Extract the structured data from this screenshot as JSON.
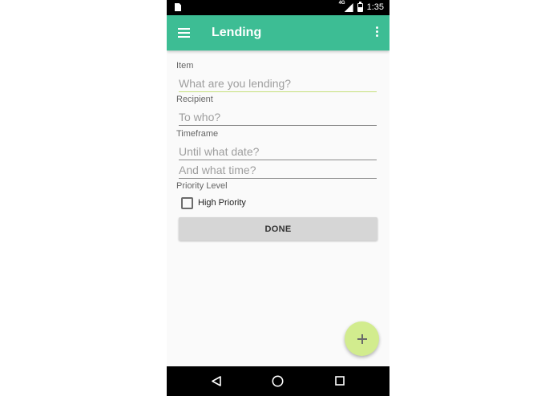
{
  "status_bar": {
    "network_label": "4G",
    "time": "1:35",
    "icons": [
      "sim-card-icon",
      "signal-icon",
      "battery-icon"
    ]
  },
  "app_bar": {
    "title": "Lending",
    "background_color": "#3dbd94",
    "icons": [
      "menu-icon",
      "overflow-menu-icon"
    ]
  },
  "form": {
    "item": {
      "label": "Item",
      "value": "",
      "placeholder": "What are you lending?"
    },
    "recipient": {
      "label": "Recipient",
      "value": "",
      "placeholder": "To who?"
    },
    "timeframe": {
      "label": "Timeframe",
      "date": {
        "value": "",
        "placeholder": "Until what date?"
      },
      "time": {
        "value": "",
        "placeholder": "And what time?"
      }
    },
    "priority": {
      "label": "Priority Level",
      "checkbox_label": "High Priority",
      "checked": false
    },
    "done_label": "DONE"
  },
  "fab": {
    "icon": "plus-icon",
    "color": "#d2ec8e"
  },
  "nav_bar": {
    "icons": [
      "back-icon",
      "home-icon",
      "recents-icon"
    ]
  }
}
